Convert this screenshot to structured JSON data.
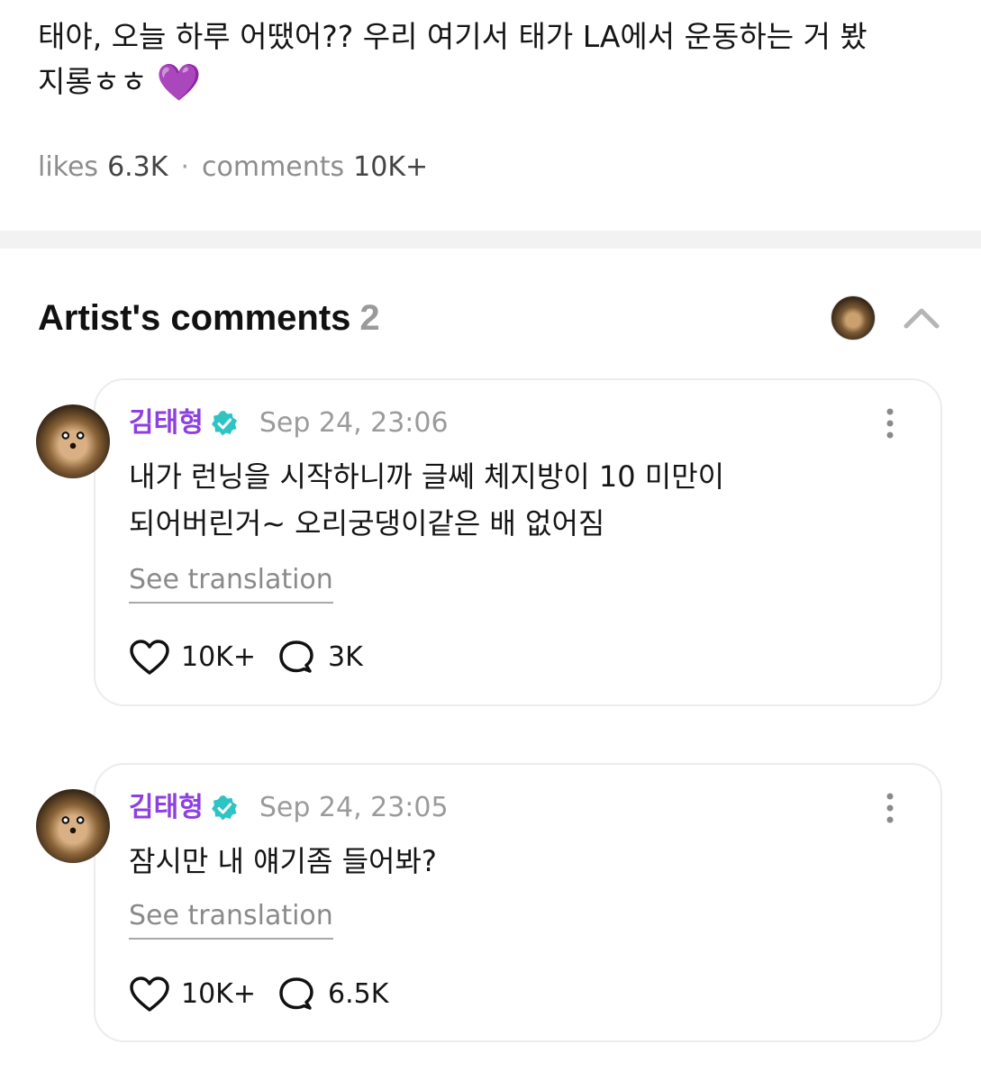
{
  "post": {
    "text_line1": "태야, 오늘 하루 어땠어?? 우리 여기서 태가 LA에서 운동하는 거 봤",
    "text_line2": "지롱ㅎㅎ",
    "emoji": "💜"
  },
  "stats": {
    "likes_label": "likes",
    "likes_value": "6.3K",
    "separator": "·",
    "comments_label": "comments",
    "comments_value": "10K+"
  },
  "section": {
    "title": "Artist's comments",
    "count": "2"
  },
  "comments": [
    {
      "author": "김태형",
      "time": "Sep 24, 23:06",
      "text_line1": "내가 런닝을 시작하니까 글쎄 체지방이 10 미만이",
      "text_line2": "되어버린거~ 오리궁댕이같은 배 없어짐",
      "translate_label": "See translation",
      "likes": "10K+",
      "replies": "3K"
    },
    {
      "author": "김태형",
      "time": "Sep 24, 23:05",
      "text_line1": "잠시만 내 얘기좀 들어봐?",
      "translate_label": "See translation",
      "likes": "10K+",
      "replies": "6.5K"
    }
  ],
  "colors": {
    "author_name": "#8e3fe0",
    "verified_badge": "#2fc4c4",
    "heart_emoji": "#a64ff0"
  },
  "icons": {
    "verified": "verified-badge-icon",
    "more": "more-vertical-icon",
    "like": "heart-icon",
    "reply": "speech-bubble-icon",
    "collapse": "chevron-up-icon"
  }
}
